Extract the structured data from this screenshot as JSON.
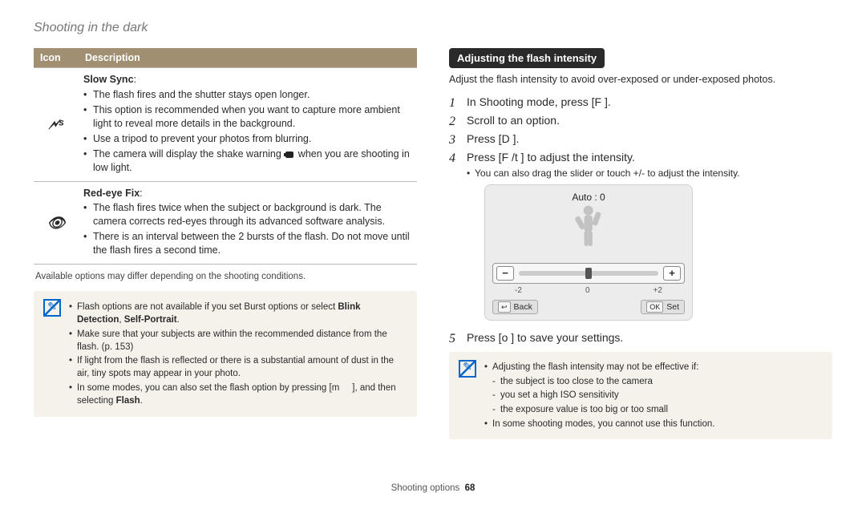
{
  "page": {
    "title": "Shooting in the dark",
    "footer_section": "Shooting options",
    "footer_page": "68"
  },
  "table": {
    "headers": {
      "icon": "Icon",
      "desc": "Description"
    },
    "rows": [
      {
        "icon_name": "slow-sync-icon",
        "title": "Slow Sync",
        "bullets": [
          "The flash fires and the shutter stays open longer.",
          "This option is recommended when you want to capture more ambient light to reveal more details in the background.",
          "Use a tripod to prevent your photos from blurring.",
          "The camera will display the shake warning  when you are shooting in low light."
        ]
      },
      {
        "icon_name": "red-eye-fix-icon",
        "title": "Red-eye Fix",
        "bullets": [
          "The flash fires twice when the subject or background is dark. The camera corrects red-eyes through its advanced software analysis.",
          "There is an interval between the 2 bursts of the flash. Do not move until the flash fires a second time."
        ]
      }
    ],
    "footnote": "Available options may differ depending on the shooting conditions."
  },
  "note_left": {
    "items": [
      {
        "html_parts": [
          "Flash options are not available if you set Burst options or select ",
          "Blink Detection",
          ", ",
          "Self-Portrait",
          "."
        ],
        "bold_idx": [
          1,
          3
        ]
      },
      {
        "text": "Make sure that your subjects are within the recommended distance from the flash. (p. 153)"
      },
      {
        "text": "If light from the flash is reflected or there is a substantial amount of dust in the air, tiny spots may appear in your photo."
      },
      {
        "html_parts": [
          "In some modes, you can also set the flash option by pressing [m     ], and then selecting ",
          "Flash",
          "."
        ],
        "bold_idx": [
          1
        ]
      }
    ]
  },
  "right": {
    "heading": "Adjusting the flash intensity",
    "intro": "Adjust the flash intensity to avoid over-exposed or under-exposed photos.",
    "steps": [
      {
        "text": "In Shooting mode, press [F  ]."
      },
      {
        "text": "Scroll to an option."
      },
      {
        "text": "Press [D      ]."
      },
      {
        "text": "Press [F /t  ] to adjust the intensity.",
        "sub": [
          "You can also drag the slider or touch +/- to adjust the intensity."
        ]
      },
      {
        "text": "Press [o    ] to save your settings."
      }
    ],
    "screen": {
      "label": "Auto : 0",
      "ticks": [
        "-2",
        "0",
        "+2"
      ],
      "back": "Back",
      "set": "Set",
      "ok": "OK"
    }
  },
  "note_right": {
    "lead": "Adjusting the flash intensity may not be effective if:",
    "sub": [
      "the subject is too close to the camera",
      "you set a high ISO sensitivity",
      "the exposure value is too big or too small"
    ],
    "last": "In some shooting modes, you cannot use this function."
  }
}
